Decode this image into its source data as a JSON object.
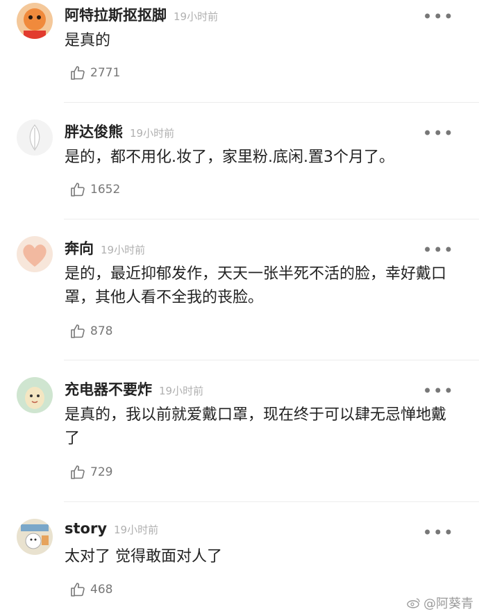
{
  "comments": [
    {
      "username": "阿特拉斯抠抠脚",
      "time": "19小时前",
      "text": "是真的",
      "likes": "2771",
      "avatar_icon": "orange-cartoon-avatar"
    },
    {
      "username": "胖达俊熊",
      "time": "19小时前",
      "text": "是的，都不用化.妆了，家里粉.底闲.置3个月了。",
      "likes": "1652",
      "avatar_icon": "white-feather-avatar"
    },
    {
      "username": "奔向",
      "time": "19小时前",
      "text": "是的，最近抑郁发作，天天一张半死不活的脸，幸好戴口罩，其他人看不全我的丧脸。",
      "likes": "878",
      "avatar_icon": "pink-heart-avatar"
    },
    {
      "username": "充电器不要炸",
      "time": "19小时前",
      "text": "是真的，我以前就爱戴口罩，现在终于可以肆无忌惮地戴了",
      "likes": "729",
      "avatar_icon": "cartoon-character-avatar"
    },
    {
      "username": "story",
      "time": "19小时前",
      "text": "太对了 觉得敢面对人了",
      "likes": "468",
      "avatar_icon": "sticker-avatar"
    }
  ],
  "more_label": "•••",
  "watermark": "@阿葵青"
}
